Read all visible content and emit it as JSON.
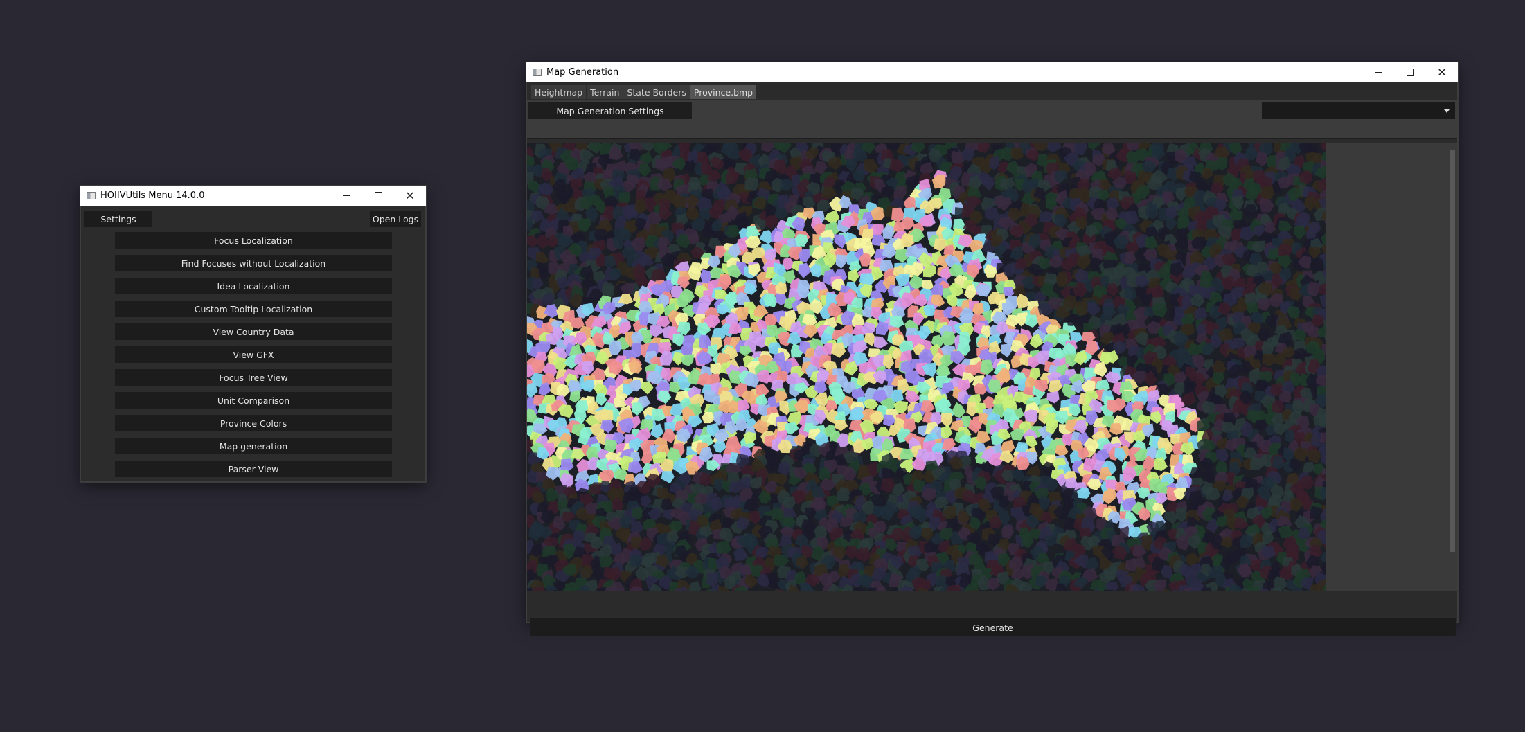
{
  "menu_window": {
    "title": "HOIIVUtils Menu 14.0.0",
    "settings_label": "Settings",
    "open_logs_label": "Open Logs",
    "buttons": [
      "Focus Localization",
      "Find Focuses without Localization",
      "Idea Localization",
      "Custom Tooltip Localization",
      "View Country Data",
      "View GFX",
      "Focus Tree View",
      "Unit Comparison",
      "Province Colors",
      "Map generation",
      "Parser View"
    ]
  },
  "map_window": {
    "title": "Map Generation",
    "tabs": [
      {
        "label": "Heightmap",
        "active": false
      },
      {
        "label": "Terrain",
        "active": false
      },
      {
        "label": "State Borders",
        "active": false
      },
      {
        "label": "Province.bmp",
        "active": true
      }
    ],
    "settings_button": "Map Generation Settings",
    "dropdown_value": "",
    "generate_label": "Generate",
    "image": {
      "subject": "province-voronoi-map",
      "palette_land": [
        "#e58fd8",
        "#9b8af0",
        "#8ee08f",
        "#f0e08a",
        "#7fd6f0",
        "#f08f8f",
        "#c8f07a",
        "#f0b27a",
        "#8af0d0",
        "#d0a0f0",
        "#f5f5a0",
        "#a0c0f0"
      ],
      "palette_sea": [
        "#1e3a2a",
        "#2a2a45",
        "#3a1e2a",
        "#1e2e3a",
        "#332a1e",
        "#2a3a3a",
        "#1a1a2a",
        "#3a2a40"
      ]
    }
  },
  "colors": {
    "desktop": "#2a2833",
    "window_bg": "#2b2b2b",
    "button_bg": "#1c1c1c"
  }
}
